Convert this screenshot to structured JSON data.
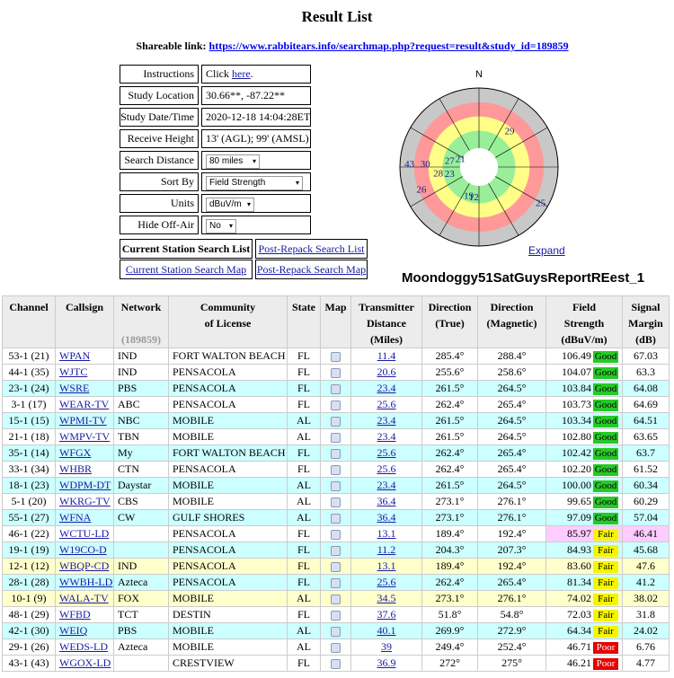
{
  "page": {
    "title": "Result List",
    "share_label": "Shareable link:",
    "share_url": "https://www.rabbitears.info/searchmap.php?request=result&study_id=189859"
  },
  "form": {
    "instructions_label": "Instructions",
    "instructions_prefix": "Click ",
    "instructions_link": "here",
    "instructions_suffix": ".",
    "location_label": "Study Location",
    "location_value": "30.66**, -87.22**",
    "datetime_label": "Study Date/Time",
    "datetime_value": "2020-12-18 14:04:28ET",
    "height_label": "Receive Height",
    "height_value": "13' (AGL); 99' (AMSL)",
    "distance_label": "Search Distance",
    "distance_value": "80 miles",
    "sortby_label": "Sort By",
    "sortby_value": "Field Strength",
    "units_label": "Units",
    "units_value": "dBuV/m",
    "hide_label": "Hide Off-Air",
    "hide_value": "No",
    "btn_current_list": "Current Station Search List",
    "btn_repack_list": "Post-Repack Search List",
    "btn_current_map": "Current Station Search Map",
    "btn_repack_map": "Post-Repack Search Map"
  },
  "radar": {
    "north_label": "N",
    "expand_label": "Expand",
    "name": "Moondoggy51SatGuysReportREest_1",
    "ring_colors": [
      "#c8c8c8",
      "#ff9999",
      "#ffff88",
      "#99ee99",
      "#ffffff"
    ],
    "markers": [
      {
        "label": "29",
        "angle": 40,
        "ring": 0.6
      },
      {
        "label": "25",
        "angle": 120,
        "ring": 0.9
      },
      {
        "label": "12",
        "angle": 190,
        "ring": 0.38
      },
      {
        "label": "19",
        "angle": 200,
        "ring": 0.38
      },
      {
        "label": "26",
        "angle": 249,
        "ring": 0.78
      },
      {
        "label": "43",
        "angle": 273,
        "ring": 0.88
      },
      {
        "label": "30",
        "angle": 274,
        "ring": 0.68
      },
      {
        "label": "28",
        "angle": 262,
        "ring": 0.52
      },
      {
        "label": "23",
        "angle": 258,
        "ring": 0.38
      },
      {
        "label": "27",
        "angle": 283,
        "ring": 0.38
      },
      {
        "label": "21",
        "angle": 295,
        "ring": 0.26
      }
    ]
  },
  "table": {
    "headers": {
      "channel": "Channel",
      "callsign": "Callsign",
      "network": "Network",
      "network_count": "(189859)",
      "community1": "Community",
      "community2": "of License",
      "state": "State",
      "map": "Map",
      "distance1": "Transmitter",
      "distance2": "Distance",
      "distance3": "(Miles)",
      "dir_true1": "Direction",
      "dir_true2": "(True)",
      "dir_mag1": "Direction",
      "dir_mag2": "(Magnetic)",
      "field1": "Field",
      "field2": "Strength",
      "field3": "(dBuV/m)",
      "margin1": "Signal",
      "margin2": "Margin",
      "margin3": "(dB)"
    },
    "rows": [
      {
        "channel": "53-1 (21)",
        "callsign": "WPAN",
        "network": "IND",
        "community": "FORT WALTON BEACH",
        "state": "FL",
        "distance": "11.4",
        "dir_true": "285.4°",
        "dir_mag": "288.4°",
        "field": "106.49",
        "rating": "Good",
        "margin": "67.03",
        "bg": "#ffffff",
        "field_bg": "",
        "margin_bg": ""
      },
      {
        "channel": "44-1 (35)",
        "callsign": "WJTC",
        "network": "IND",
        "community": "PENSACOLA",
        "state": "FL",
        "distance": "20.6",
        "dir_true": "255.6°",
        "dir_mag": "258.6°",
        "field": "104.07",
        "rating": "Good",
        "margin": "63.3",
        "bg": "#ffffff",
        "field_bg": "",
        "margin_bg": ""
      },
      {
        "channel": "23-1 (24)",
        "callsign": "WSRE",
        "network": "PBS",
        "community": "PENSACOLA",
        "state": "FL",
        "distance": "23.4",
        "dir_true": "261.5°",
        "dir_mag": "264.5°",
        "field": "103.84",
        "rating": "Good",
        "margin": "64.08",
        "bg": "#ccffff",
        "field_bg": "",
        "margin_bg": ""
      },
      {
        "channel": "3-1 (17)",
        "callsign": "WEAR-TV",
        "network": "ABC",
        "community": "PENSACOLA",
        "state": "FL",
        "distance": "25.6",
        "dir_true": "262.4°",
        "dir_mag": "265.4°",
        "field": "103.73",
        "rating": "Good",
        "margin": "64.69",
        "bg": "#ffffff",
        "field_bg": "",
        "margin_bg": ""
      },
      {
        "channel": "15-1 (15)",
        "callsign": "WPMI-TV",
        "network": "NBC",
        "community": "MOBILE",
        "state": "AL",
        "distance": "23.4",
        "dir_true": "261.5°",
        "dir_mag": "264.5°",
        "field": "103.34",
        "rating": "Good",
        "margin": "64.51",
        "bg": "#ccffff",
        "field_bg": "",
        "margin_bg": ""
      },
      {
        "channel": "21-1 (18)",
        "callsign": "WMPV-TV",
        "network": "TBN",
        "community": "MOBILE",
        "state": "AL",
        "distance": "23.4",
        "dir_true": "261.5°",
        "dir_mag": "264.5°",
        "field": "102.80",
        "rating": "Good",
        "margin": "63.65",
        "bg": "#ffffff",
        "field_bg": "",
        "margin_bg": ""
      },
      {
        "channel": "35-1 (14)",
        "callsign": "WFGX",
        "network": "My",
        "community": "FORT WALTON BEACH",
        "state": "FL",
        "distance": "25.6",
        "dir_true": "262.4°",
        "dir_mag": "265.4°",
        "field": "102.42",
        "rating": "Good",
        "margin": "63.7",
        "bg": "#ccffff",
        "field_bg": "",
        "margin_bg": ""
      },
      {
        "channel": "33-1 (34)",
        "callsign": "WHBR",
        "network": "CTN",
        "community": "PENSACOLA",
        "state": "FL",
        "distance": "25.6",
        "dir_true": "262.4°",
        "dir_mag": "265.4°",
        "field": "102.20",
        "rating": "Good",
        "margin": "61.52",
        "bg": "#ffffff",
        "field_bg": "",
        "margin_bg": ""
      },
      {
        "channel": "18-1 (23)",
        "callsign": "WDPM-DT",
        "network": "Daystar",
        "community": "MOBILE",
        "state": "AL",
        "distance": "23.4",
        "dir_true": "261.5°",
        "dir_mag": "264.5°",
        "field": "100.00",
        "rating": "Good",
        "margin": "60.34",
        "bg": "#ccffff",
        "field_bg": "",
        "margin_bg": ""
      },
      {
        "channel": "5-1 (20)",
        "callsign": "WKRG-TV",
        "network": "CBS",
        "community": "MOBILE",
        "state": "AL",
        "distance": "36.4",
        "dir_true": "273.1°",
        "dir_mag": "276.1°",
        "field": "99.65",
        "rating": "Good",
        "margin": "60.29",
        "bg": "#ffffff",
        "field_bg": "",
        "margin_bg": ""
      },
      {
        "channel": "55-1 (27)",
        "callsign": "WFNA",
        "network": "CW",
        "community": "GULF SHORES",
        "state": "AL",
        "distance": "36.4",
        "dir_true": "273.1°",
        "dir_mag": "276.1°",
        "field": "97.09",
        "rating": "Good",
        "margin": "57.04",
        "bg": "#ccffff",
        "field_bg": "",
        "margin_bg": ""
      },
      {
        "channel": "46-1 (22)",
        "callsign": "WCTU-LD",
        "network": "",
        "community": "PENSACOLA",
        "state": "FL",
        "distance": "13.1",
        "dir_true": "189.4°",
        "dir_mag": "192.4°",
        "field": "85.97",
        "rating": "Fair",
        "margin": "46.41",
        "bg": "#ffffff",
        "field_bg": "#ffccff",
        "margin_bg": "#ffccff"
      },
      {
        "channel": "19-1 (19)",
        "callsign": "W19CO-D",
        "network": "",
        "community": "PENSACOLA",
        "state": "FL",
        "distance": "11.2",
        "dir_true": "204.3°",
        "dir_mag": "207.3°",
        "field": "84.93",
        "rating": "Fair",
        "margin": "45.68",
        "bg": "#ccffff",
        "field_bg": "",
        "margin_bg": ""
      },
      {
        "channel": "12-1 (12)",
        "callsign": "WBQP-CD",
        "network": "IND",
        "community": "PENSACOLA",
        "state": "FL",
        "distance": "13.1",
        "dir_true": "189.4°",
        "dir_mag": "192.4°",
        "field": "83.60",
        "rating": "Fair",
        "margin": "47.6",
        "bg": "#ffffcc",
        "field_bg": "",
        "margin_bg": ""
      },
      {
        "channel": "28-1 (28)",
        "callsign": "WWBH-LD",
        "network": "Azteca",
        "community": "PENSACOLA",
        "state": "FL",
        "distance": "25.6",
        "dir_true": "262.4°",
        "dir_mag": "265.4°",
        "field": "81.34",
        "rating": "Fair",
        "margin": "41.2",
        "bg": "#ccffff",
        "field_bg": "",
        "margin_bg": ""
      },
      {
        "channel": "10-1 (9)",
        "callsign": "WALA-TV",
        "network": "FOX",
        "community": "MOBILE",
        "state": "AL",
        "distance": "34.5",
        "dir_true": "273.1°",
        "dir_mag": "276.1°",
        "field": "74.02",
        "rating": "Fair",
        "margin": "38.02",
        "bg": "#ffffcc",
        "field_bg": "",
        "margin_bg": ""
      },
      {
        "channel": "48-1 (29)",
        "callsign": "WFBD",
        "network": "TCT",
        "community": "DESTIN",
        "state": "FL",
        "distance": "37.6",
        "dir_true": "51.8°",
        "dir_mag": "54.8°",
        "field": "72.03",
        "rating": "Fair",
        "margin": "31.8",
        "bg": "#ffffff",
        "field_bg": "",
        "margin_bg": ""
      },
      {
        "channel": "42-1 (30)",
        "callsign": "WEIQ",
        "network": "PBS",
        "community": "MOBILE",
        "state": "AL",
        "distance": "40.1",
        "dir_true": "269.9°",
        "dir_mag": "272.9°",
        "field": "64.34",
        "rating": "Fair",
        "margin": "24.02",
        "bg": "#ccffff",
        "field_bg": "",
        "margin_bg": ""
      },
      {
        "channel": "29-1 (26)",
        "callsign": "WEDS-LD",
        "network": "Azteca",
        "community": "MOBILE",
        "state": "AL",
        "distance": "39",
        "dir_true": "249.4°",
        "dir_mag": "252.4°",
        "field": "46.71",
        "rating": "Poor",
        "margin": "6.76",
        "bg": "#ffffff",
        "field_bg": "",
        "margin_bg": ""
      },
      {
        "channel": "43-1 (43)",
        "callsign": "WGOX-LD",
        "network": "",
        "community": "CRESTVIEW",
        "state": "FL",
        "distance": "36.9",
        "dir_true": "272°",
        "dir_mag": "275°",
        "field": "46.21",
        "rating": "Poor",
        "margin": "4.77",
        "bg": "#ffffff",
        "field_bg": "",
        "margin_bg": ""
      }
    ]
  }
}
